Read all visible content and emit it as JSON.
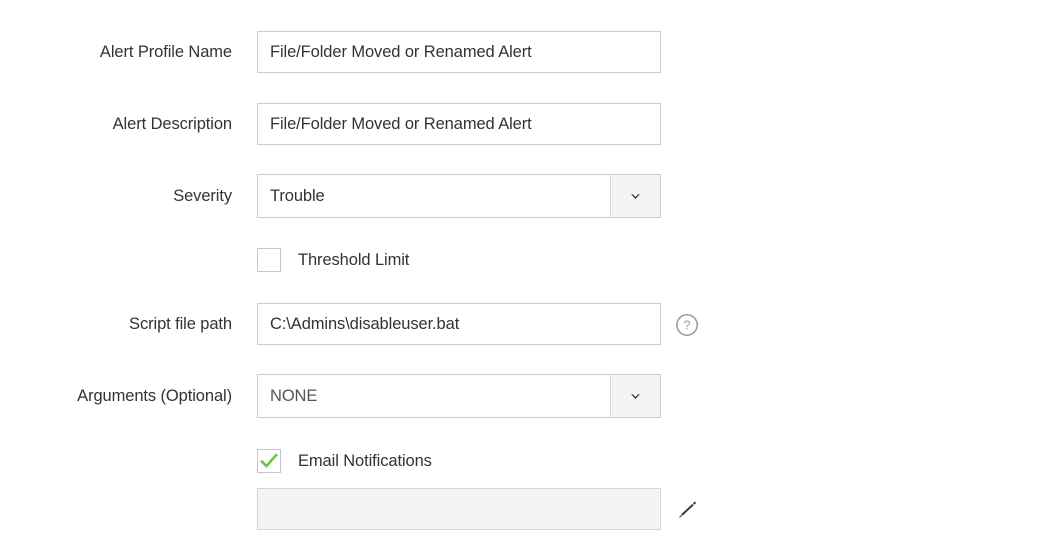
{
  "form": {
    "rows": [
      {
        "label": "Alert Profile Name",
        "value": "File/Folder Moved or Renamed Alert",
        "placeholder": ""
      },
      {
        "label": "Alert Description",
        "value": "File/Folder Moved or Renamed Alert",
        "placeholder": ""
      },
      {
        "label": "Severity",
        "value": "Trouble",
        "placeholder": ""
      },
      {
        "label": "Script file path",
        "value": "C:\\Admins\\disableuser.bat",
        "placeholder": ""
      },
      {
        "label": "Arguments (Optional)",
        "value": "NONE",
        "placeholder": ""
      },
      {
        "label": "",
        "value": "",
        "placeholder": ""
      }
    ],
    "checkboxes": [
      {
        "label": "Threshold Limit",
        "checked": false
      },
      {
        "label": "Email Notifications",
        "checked": true
      }
    ],
    "icons": {
      "help": "help-circle-icon",
      "pencil": "pencil-edit-icon",
      "chevron": "chevron-down-icon",
      "tick": "check-icon"
    },
    "colors": {
      "checked_tick": "#6cc24a",
      "border": "#cccccc",
      "text": "#333333",
      "button_fill": "#f4f4f4",
      "disabled_fill": "#f4f4f4"
    }
  }
}
